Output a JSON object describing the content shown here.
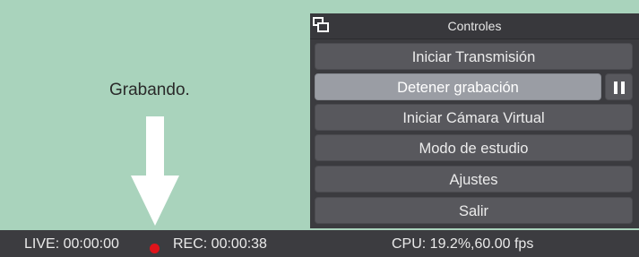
{
  "annotation": {
    "text": "Grabando."
  },
  "panel": {
    "title": "Controles",
    "icon": "dock-float-icon"
  },
  "controls": [
    {
      "label": "Iniciar Transmisión"
    },
    {
      "label": "Detener grabación"
    },
    {
      "label": "Iniciar Cámara Virtual"
    },
    {
      "label": "Modo de estudio"
    },
    {
      "label": "Ajustes"
    },
    {
      "label": "Salir"
    }
  ],
  "pause_button": {
    "icon": "pause-icon"
  },
  "status_bar": {
    "live": "LIVE: 00:00:00",
    "rec": "REC: 00:00:38",
    "cpu": "CPU: 19.2%,60.00 fps",
    "rec_indicator_color": "#e0141b"
  },
  "colors": {
    "canvas": "#a9d3bc",
    "panel": "#3b3b3f",
    "button": "#58585d",
    "button_active": "#9a9da4",
    "status_bar": "#3c3c40"
  }
}
